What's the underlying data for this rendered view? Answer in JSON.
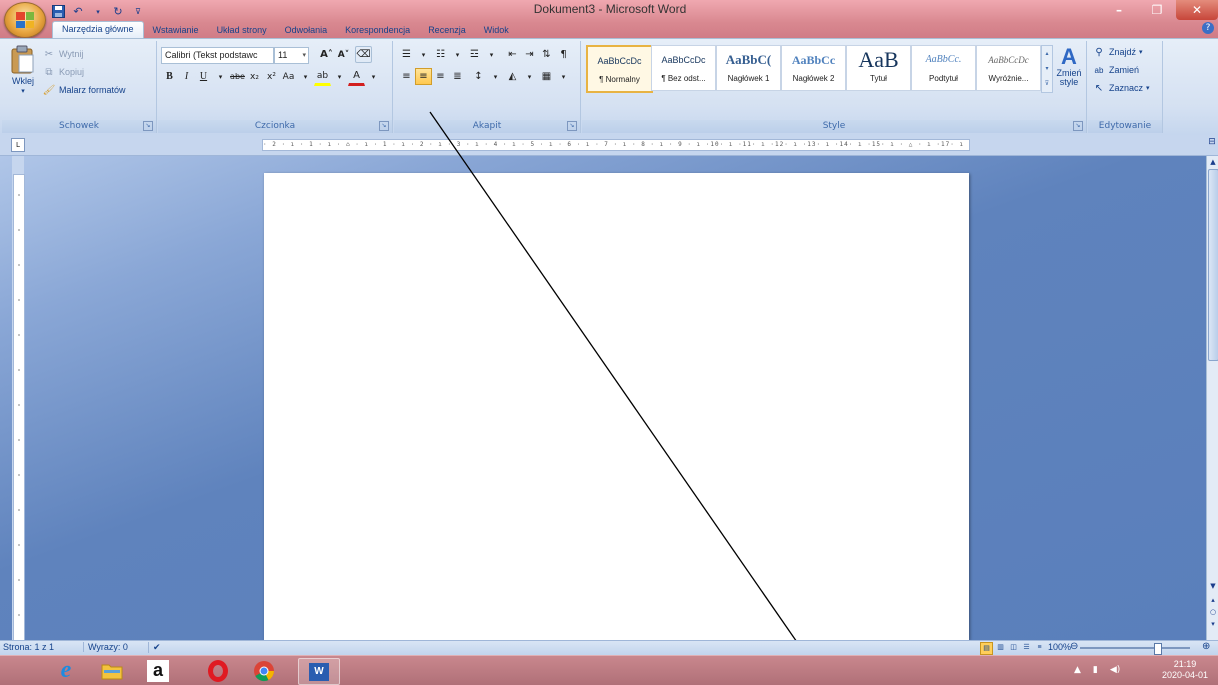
{
  "window": {
    "title": "Dokument3 - Microsoft Word",
    "minimize": "–",
    "maximize": "❐",
    "close": "✕",
    "help": "?"
  },
  "qat": [
    "save-icon",
    "undo-icon",
    "redo-icon",
    "customize-qat-icon"
  ],
  "tabs": [
    "Narzędzia główne",
    "Wstawianie",
    "Układ strony",
    "Odwołania",
    "Korespondencja",
    "Recenzja",
    "Widok"
  ],
  "active_tab": "Narzędzia główne",
  "clipboard": {
    "paste": "Wklej",
    "cut": "Wytnij",
    "copy": "Kopiuj",
    "format_painter": "Malarz formatów",
    "label": "Schowek"
  },
  "font": {
    "family": "Calibri (Tekst podstawc",
    "size": "11",
    "label": "Czcionka",
    "bold": "B",
    "italic": "I",
    "underline": "U",
    "strike": "abe",
    "subscript": "x₂",
    "superscript": "x²",
    "change_case": "Aa",
    "grow": "A˄",
    "shrink": "A˅"
  },
  "paragraph": {
    "label": "Akapit",
    "active_alignment": "center"
  },
  "styles": {
    "label": "Style",
    "items": [
      {
        "preview": "AaBbCcDc",
        "name": "¶ Normalny",
        "selected": true
      },
      {
        "preview": "AaBbCcDc",
        "name": "¶ Bez odst...",
        "selected": false
      },
      {
        "preview": "AaBbC(",
        "name": "Nagłówek 1",
        "selected": false
      },
      {
        "preview": "AaBbCc",
        "name": "Nagłówek 2",
        "selected": false
      },
      {
        "preview": "AaB",
        "name": "Tytuł",
        "selected": false
      },
      {
        "preview": "AaBbCc.",
        "name": "Podtytuł",
        "selected": false
      },
      {
        "preview": "AaBbCcDc",
        "name": "Wyróżnie...",
        "selected": false
      }
    ],
    "change_styles": "Zmień style"
  },
  "editing": {
    "label": "Edytowanie",
    "find": "Znajdź",
    "replace": "Zamień",
    "select": "Zaznacz"
  },
  "ruler": {
    "horizontal": "· 2 · ı · 1 · ı · ⌂ · ı · 1 · ı · 2 · ı · 3 · ı · 4 · ı · 5 · ı · 6 · ı · 7 · ı · 8 · ı · 9 · ı ·10· ı ·11· ı ·12· ı ·13· ı ·14· ı ·15· ı · △ · ı ·17· ı ·18·",
    "tab_selector": "L"
  },
  "status": {
    "page": "Strona: 1 z 1",
    "words": "Wyrazy: 0",
    "zoom": "100%",
    "zoom_level": 100
  },
  "taskbar": {
    "apps": [
      "ie-icon",
      "file-explorer-icon",
      "amazon-icon",
      "opera-icon",
      "chrome-icon",
      "word-icon"
    ],
    "time": "21:19",
    "date": "2020-04-01"
  }
}
